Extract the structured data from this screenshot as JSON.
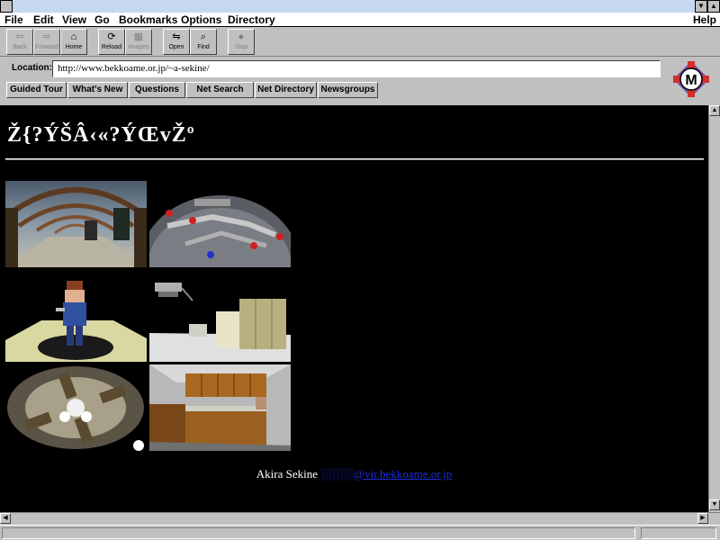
{
  "window": {
    "menu": [
      "File",
      "Edit",
      "View",
      "Go",
      "Bookmarks",
      "Options",
      "Directory",
      "Help"
    ],
    "menu_underline": [
      "F",
      "E",
      "V",
      "G",
      "B",
      "O",
      "D",
      "H"
    ]
  },
  "toolbar": {
    "buttons": [
      {
        "label": "Back",
        "icon": "back-arrow-icon",
        "enabled": false
      },
      {
        "label": "Forward",
        "icon": "forward-arrow-icon",
        "enabled": false
      },
      {
        "label": "Home",
        "icon": "home-icon",
        "enabled": true
      },
      {
        "label": "Reload",
        "icon": "reload-icon",
        "enabled": true
      },
      {
        "label": "Images",
        "icon": "images-icon",
        "enabled": false
      },
      {
        "label": "Open",
        "icon": "open-icon",
        "enabled": true
      },
      {
        "label": "Find",
        "icon": "find-icon",
        "enabled": true
      },
      {
        "label": "Stop",
        "icon": "stop-icon",
        "enabled": false
      }
    ]
  },
  "location": {
    "label": "Location:",
    "url": "http://www.bekkoame.or.jp/~a-sekine/"
  },
  "directory_buttons": [
    "Guided Tour",
    "What's New",
    "Questions",
    "Net Search",
    "Net Directory",
    "Newsgroups"
  ],
  "logo": {
    "letter": "M"
  },
  "page": {
    "heading": "Ž{?ÝŠÂ‹«?ÝŒvŽº",
    "footer_name": "Akira Sekine",
    "footer_email": "░░░░@vir.bekkoame.or.jp",
    "thumbnails": [
      "arched-hall-render",
      "dome-pipes-render",
      "character-spotlight-render",
      "equipment-room-render",
      "ceiling-fan-render",
      "kitchen-render"
    ]
  },
  "colors": {
    "content_bg": "#000000",
    "link": "#1e2edc",
    "chrome": "#c0c0c0",
    "title_fill": "#c6d7f0"
  }
}
